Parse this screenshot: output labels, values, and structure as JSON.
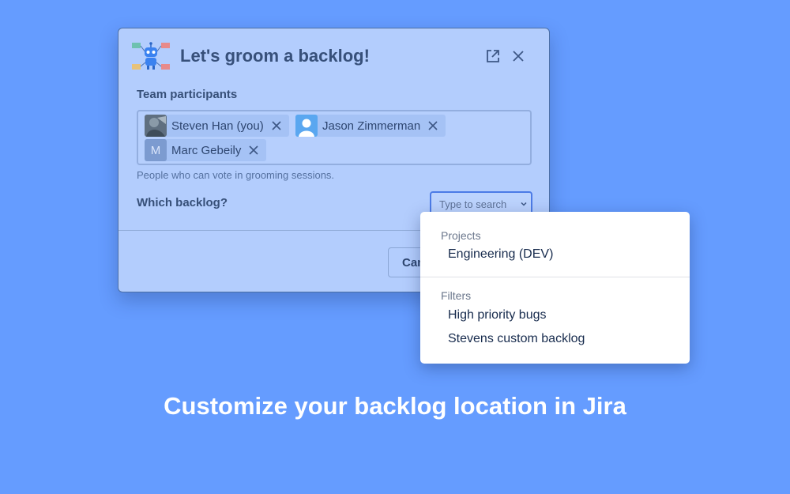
{
  "dialog": {
    "title": "Let's groom a backlog!",
    "participants_label": "Team participants",
    "participants": [
      {
        "name": "Steven Han (you)",
        "avatar": "photo"
      },
      {
        "name": "Jason Zimmerman",
        "avatar": "person-silhouette"
      },
      {
        "name": "Marc Gebeily",
        "avatar": "initial",
        "initial": "M"
      }
    ],
    "participants_hint": "People who can vote in grooming sessions.",
    "backlog_label": "Which backlog?",
    "search_placeholder": "Type to search",
    "cancel_label": "Can"
  },
  "dropdown": {
    "groups": [
      {
        "label": "Projects",
        "items": [
          "Engineering (DEV)"
        ]
      },
      {
        "label": "Filters",
        "items": [
          "High priority bugs",
          "Stevens custom backlog"
        ]
      }
    ]
  },
  "headline": "Customize your backlog location in Jira",
  "colors": {
    "background": "#659cff",
    "dialog": "#b3cdfd",
    "chip": "#a5c2f5",
    "accent": "#4c7be6",
    "headline": "#ffffff"
  }
}
